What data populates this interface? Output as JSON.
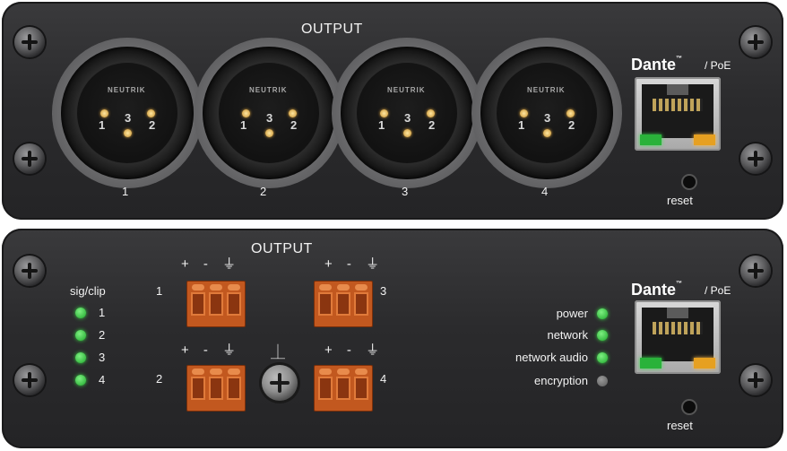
{
  "top_panel": {
    "title": "OUTPUT",
    "connectors": [
      {
        "number": "1"
      },
      {
        "number": "2"
      },
      {
        "number": "3"
      },
      {
        "number": "4"
      }
    ],
    "pin_labels": {
      "p1": "1",
      "p2": "2",
      "p3": "3"
    },
    "brand": "NEUTRIK",
    "dante_logo": "Dante",
    "tm": "™",
    "poe": "/ PoE",
    "reset_label": "reset"
  },
  "bottom_panel": {
    "title": "OUTPUT",
    "sig_clip_label": "sig/clip",
    "channels": [
      "1",
      "2",
      "3",
      "4"
    ],
    "terminal_polarity": "+ - ⏚",
    "terminals": [
      {
        "number": "1"
      },
      {
        "number": "2"
      },
      {
        "number": "3"
      },
      {
        "number": "4"
      }
    ],
    "chassis_ground_symbol": "⏊",
    "status": [
      {
        "label": "power",
        "state": "on"
      },
      {
        "label": "network",
        "state": "on"
      },
      {
        "label": "network audio",
        "state": "on"
      },
      {
        "label": "encryption",
        "state": "off"
      }
    ],
    "dante_logo": "Dante",
    "tm": "™",
    "poe": "/ PoE",
    "reset_label": "reset"
  },
  "colors": {
    "panel": "#2b2b2d",
    "led_green": "#2ab23a",
    "led_amber": "#e6a021",
    "terminal_block": "#c2581f"
  }
}
